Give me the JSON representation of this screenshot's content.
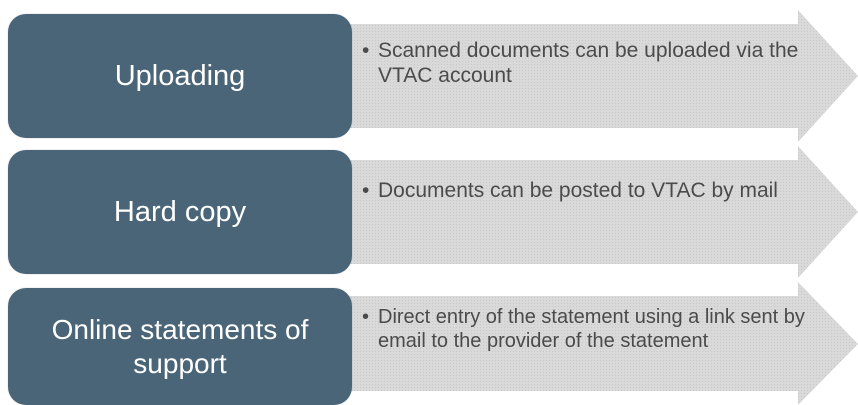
{
  "colors": {
    "label_fill": "#4a6577",
    "arrow_fill": "#d9d9d9",
    "text_dark": "#4b4b4b",
    "text_light": "#ffffff"
  },
  "rows": [
    {
      "label": "Uploading",
      "bullet": "•",
      "text": "Scanned documents can be uploaded via the VTAC account"
    },
    {
      "label": "Hard copy",
      "bullet": "•",
      "text": "Documents can be posted to VTAC by mail"
    },
    {
      "label": "Online statements of support",
      "bullet": "•",
      "text": "Direct entry of the statement using a link sent by email to the provider of the statement"
    }
  ]
}
